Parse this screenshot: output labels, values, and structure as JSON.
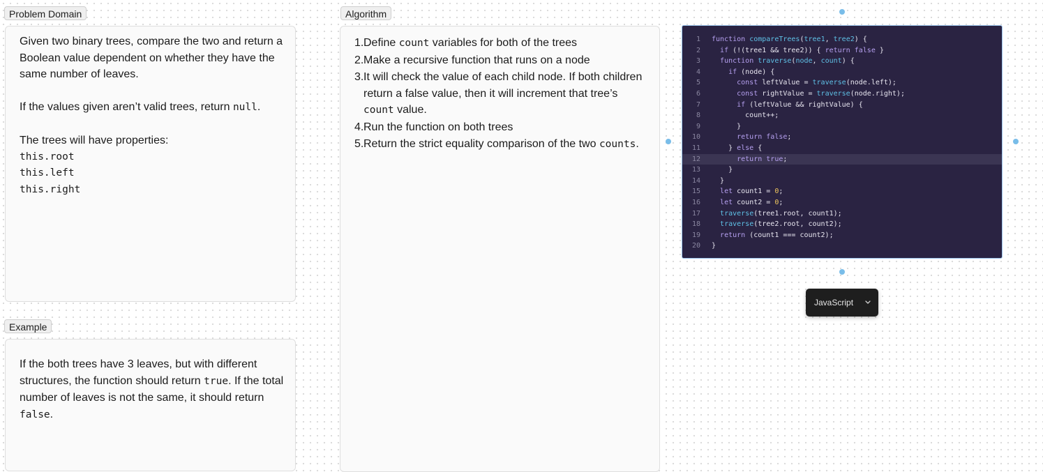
{
  "problem_domain": {
    "label": "Problem Domain",
    "paragraph1": "Given two binary trees, compare the two and return a Boolean value dependent on whether they have the same number of leaves.",
    "paragraph2_before": "If the values given aren’t valid trees, return ",
    "paragraph2_code": "null",
    "paragraph2_after": ".",
    "paragraph3": "The trees will have properties:",
    "properties": [
      "this.root",
      "this.left",
      "this.right"
    ]
  },
  "example": {
    "label": "Example",
    "t1": "If the both trees have 3 leaves, but with different structures, the function should return ",
    "c1": "true",
    "t2": ". If the total number of leaves is not the same, it should return ",
    "c2": "false",
    "t3": "."
  },
  "algorithm": {
    "label": "Algorithm",
    "steps": [
      {
        "num": "1.",
        "pre": "Define ",
        "code": "count",
        "post": " variables for both of the trees"
      },
      {
        "num": "2.",
        "pre": "Make a recursive function that runs on a node",
        "code": "",
        "post": ""
      },
      {
        "num": "3.",
        "pre": "It will check the value of each child node. If both children return a false value, then it will increment that tree’s ",
        "code": "count",
        "post": " value."
      },
      {
        "num": "4.",
        "pre": "Run the function on both trees",
        "code": "",
        "post": ""
      },
      {
        "num": "5.",
        "pre": "Return the strict equality comparison of the two ",
        "code": "counts",
        "post": "."
      }
    ]
  },
  "code_editor": {
    "language": "JavaScript",
    "highlighted_line": 12,
    "lines": [
      "function compareTrees(tree1, tree2) {",
      "  if (!(tree1 && tree2)) { return false }",
      "  function traverse(node, count) {",
      "    if (node) {",
      "      const leftValue = traverse(node.left);",
      "      const rightValue = traverse(node.right);",
      "      if (leftValue && rightValue) {",
      "        count++;",
      "      }",
      "      return false;",
      "    } else {",
      "      return true;",
      "    }",
      "  }",
      "  let count1 = 0;",
      "  let count2 = 0;",
      "  traverse(tree1.root, count1);",
      "  traverse(tree2.root, count2);",
      "  return (count1 === count2);",
      "}"
    ],
    "colors": {
      "background": "#2a2342",
      "keyword": "#b6a0f0",
      "function": "#5fc0e6",
      "number": "#f0c75e",
      "text": "#e8e6f0",
      "selection_border": "#9cc6ee"
    }
  }
}
